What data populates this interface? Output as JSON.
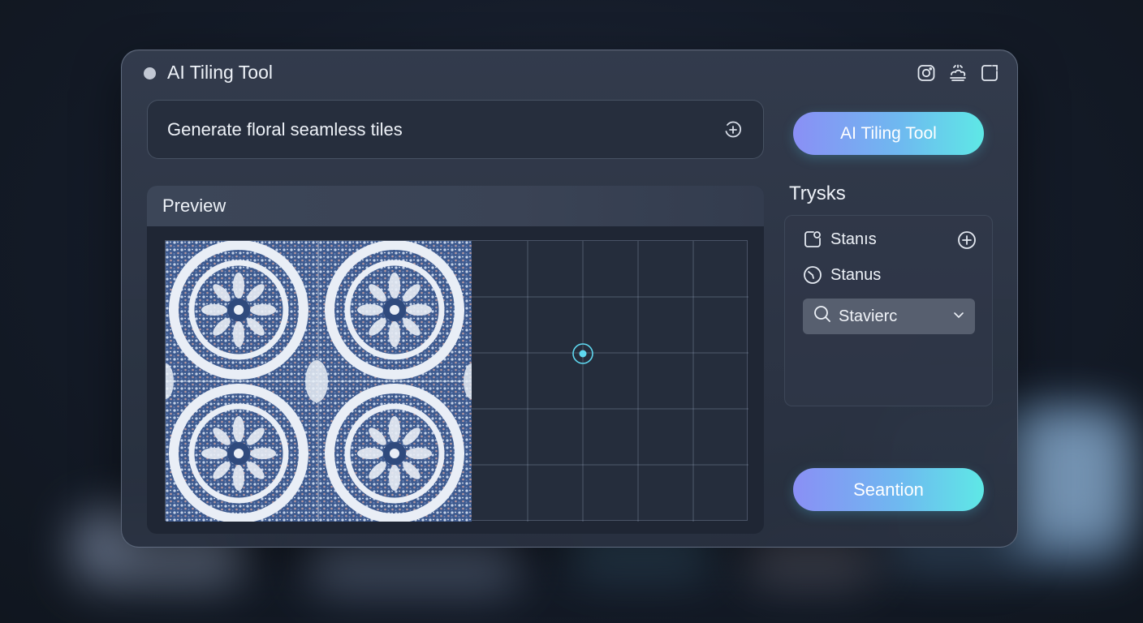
{
  "window": {
    "title": "AI Tiling Tool"
  },
  "window_icons": [
    "instagram-icon",
    "cloud-icon",
    "new-note-icon"
  ],
  "prompt": {
    "value": "Generate floral seamless tiles",
    "icon": "add-circle-icon"
  },
  "preview": {
    "label": "Preview"
  },
  "sidebar": {
    "primary_button": "AI Tiling Tool",
    "heading": "Trysks",
    "items": [
      {
        "label": "Stanıs",
        "icon": "new-note-icon"
      },
      {
        "label": "Stanus",
        "icon": "dial-icon"
      }
    ],
    "select": {
      "value": "Stavierc",
      "icon": "search-icon"
    },
    "bottom_button": "Seantion"
  },
  "colors": {
    "accent_start": "#8a8ff5",
    "accent_end": "#5ee8e6",
    "tile_blue": "#3d5a8f",
    "tile_white": "#e9eef6",
    "marker": "#5fd8f0"
  }
}
